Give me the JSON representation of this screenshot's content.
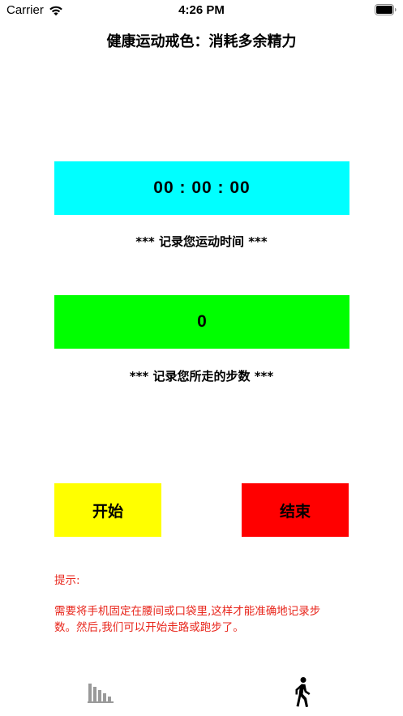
{
  "status_bar": {
    "carrier": "Carrier",
    "time": "4:26 PM",
    "icons": [
      "wifi-icon",
      "battery-icon"
    ]
  },
  "header": {
    "title": "健康运动戒色：消耗多余精力"
  },
  "timer": {
    "value": "00 : 00 : 00",
    "caption": "***  记录您运动时间  ***",
    "color": "#00ffff"
  },
  "steps": {
    "value": "0",
    "caption": "***  记录您所走的步数  ***",
    "color": "#00ff00"
  },
  "buttons": {
    "start_label": "开始",
    "start_color": "#ffff00",
    "stop_label": "结束",
    "stop_color": "#ff0000"
  },
  "tips": {
    "title": "提示:",
    "body": "需要将手机固定在腰间或口袋里,这样才能准确地记录步数。然后,我们可以开始走路或跑步了。",
    "color": "#e8261c"
  },
  "tab_bar": {
    "items": [
      {
        "icon": "bar-chart-icon",
        "selected": false
      },
      {
        "icon": "walking-person-icon",
        "selected": true
      }
    ]
  }
}
